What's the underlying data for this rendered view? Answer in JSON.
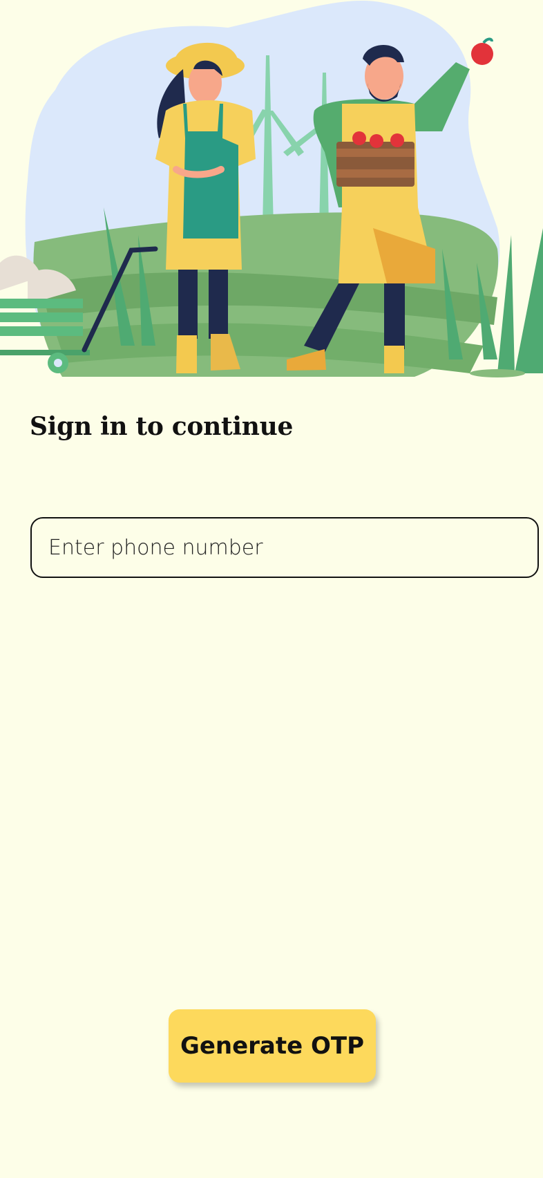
{
  "hero": {
    "illustration": "farmer-couple-illustration"
  },
  "login": {
    "title": "Sign in to continue",
    "phone_placeholder": "Enter phone number",
    "phone_value": "",
    "otp_button_label": "Generate OTP"
  },
  "colors": {
    "background": "#fdfee8",
    "button": "#fdd95c",
    "sky_blob": "#dbe8fb",
    "field_green": "#86bb7c"
  }
}
